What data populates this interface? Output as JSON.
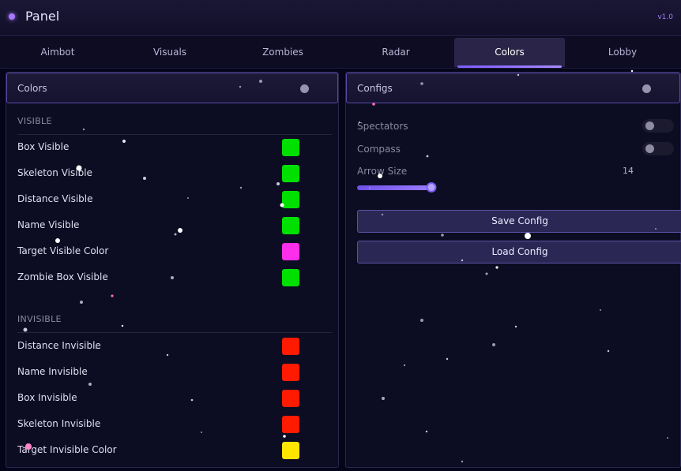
{
  "window": {
    "title": "Panel",
    "version": "v1.0"
  },
  "tabs": [
    {
      "label": "Aimbot"
    },
    {
      "label": "Visuals"
    },
    {
      "label": "Zombies"
    },
    {
      "label": "Radar"
    },
    {
      "label": "Colors",
      "active": true
    },
    {
      "label": "Lobby"
    }
  ],
  "colors_panel": {
    "title": "Colors",
    "visible_section": {
      "title": "VISIBLE",
      "items": [
        {
          "label": "Box Visible",
          "color": "#00e000"
        },
        {
          "label": "Skeleton Visible",
          "color": "#00e000"
        },
        {
          "label": "Distance Visible",
          "color": "#00e000"
        },
        {
          "label": "Name Visible",
          "color": "#00e000"
        },
        {
          "label": "Target Visible Color",
          "color": "#ff2eea"
        },
        {
          "label": "Zombie Box Visible",
          "color": "#00e000"
        }
      ]
    },
    "invisible_section": {
      "title": "INVISIBLE",
      "items": [
        {
          "label": "Distance Invisible",
          "color": "#ff1a00"
        },
        {
          "label": "Name Invisible",
          "color": "#ff1a00"
        },
        {
          "label": "Box Invisible",
          "color": "#ff1a00"
        },
        {
          "label": "Skeleton Invisible",
          "color": "#ff1a00"
        },
        {
          "label": "Target Invisible Color",
          "color": "#ffe600"
        }
      ]
    }
  },
  "configs_panel": {
    "title": "Configs",
    "toggles": [
      {
        "label": "Spectators",
        "on": false
      },
      {
        "label": "Compass",
        "on": false
      }
    ],
    "arrow_size": {
      "label": "Arrow Size",
      "value": "14",
      "fraction": 0.98
    },
    "save_label": "Save Config",
    "load_label": "Load Config"
  },
  "accent_color": "#7c5cff"
}
